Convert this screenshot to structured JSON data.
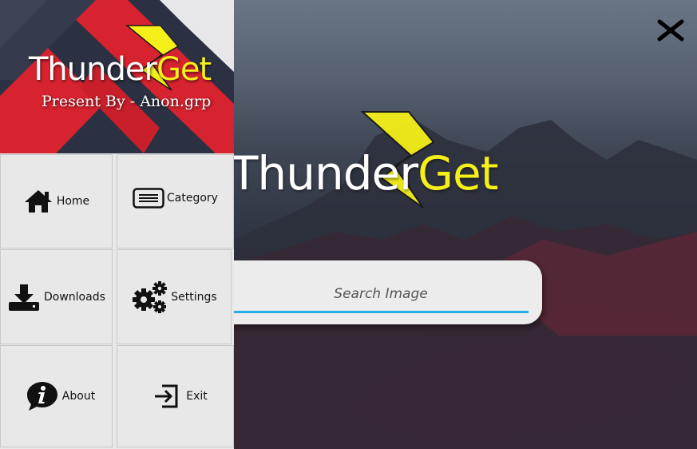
{
  "app": {
    "name_part1": "Thunder",
    "name_part2": "Get",
    "tagline": "Present By - Anon.grp"
  },
  "main_logo": {
    "name_part1": "Thunder",
    "name_part2": "Get"
  },
  "search": {
    "placeholder": "Search Image",
    "value": ""
  },
  "menu": {
    "home": "Home",
    "category": "Category",
    "downloads": "Downloads",
    "settings": "Settings",
    "about": "About",
    "exit": "Exit"
  },
  "icons": {
    "close": "close-icon",
    "home": "home-icon",
    "category": "list-icon",
    "downloads": "download-icon",
    "settings": "gears-icon",
    "about": "info-icon",
    "exit": "exit-icon"
  },
  "colors": {
    "accent_yellow": "#f5ef1a",
    "search_underline": "#22aee6",
    "panel_bg": "#e8e8e8",
    "banner_red": "#d7232f"
  }
}
